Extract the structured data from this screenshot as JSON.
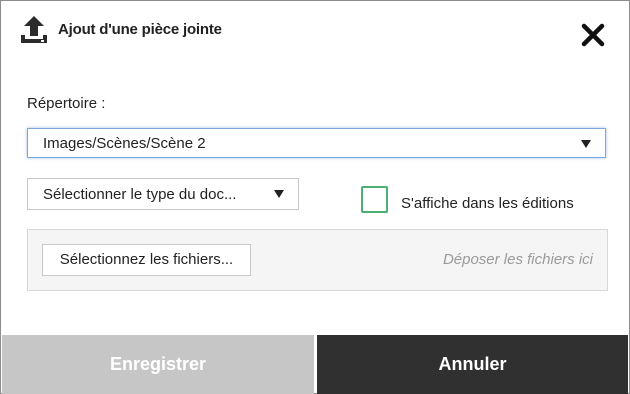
{
  "dialog": {
    "title": "Ajout d'une pièce jointe",
    "icons": {
      "header": "upload-icon",
      "close": "close-icon"
    }
  },
  "form": {
    "directory_label": "Répertoire :",
    "directory_value": "Images/Scènes/Scène 2",
    "doc_type_value": "Sélectionner le type du doc...",
    "show_in_editions_label": "S'affiche dans les éditions",
    "show_in_editions_checked": false
  },
  "dropzone": {
    "select_files_label": "Sélectionnez les fichiers...",
    "drop_hint": "Déposer les fichiers ici"
  },
  "footer": {
    "save_label": "Enregistrer",
    "cancel_label": "Annuler"
  },
  "colors": {
    "save_bg": "#c6c6c6",
    "cancel_bg": "#303030",
    "checkbox_border": "#4caf73",
    "focus_border": "#7da7d9"
  }
}
